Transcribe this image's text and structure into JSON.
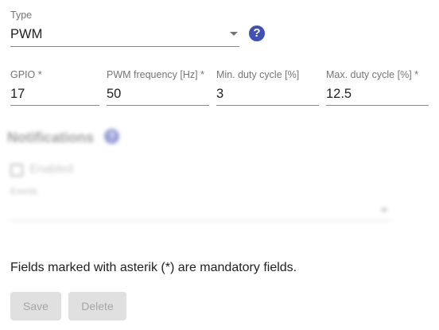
{
  "type_select": {
    "label": "Type",
    "value": "PWM",
    "help_icon": "?"
  },
  "inputs": {
    "gpio": {
      "label": "GPIO *",
      "value": "17"
    },
    "pwm_frequency": {
      "label": "PWM frequency [Hz] *",
      "value": "50"
    },
    "min_duty_cycle": {
      "label": "Min. duty cycle [%]",
      "value": "3"
    },
    "max_duty_cycle": {
      "label": "Max. duty cycle [%] *",
      "value": "12.5"
    }
  },
  "notifications": {
    "title": "Notifications",
    "help_icon": "?",
    "enabled_label": "Enabled",
    "events_label": "Events"
  },
  "footer": {
    "mandatory_note": "Fields marked with asterik (*) are mandatory fields.",
    "save_label": "Save",
    "delete_label": "Delete"
  },
  "colors": {
    "accent": "#3f51b5",
    "disabled_button_bg": "#e0e0e0",
    "disabled_button_text": "#a6a6a6"
  },
  "icons": {
    "type_help": "question-circle-icon",
    "notifications_help": "question-circle-icon",
    "dropdown": "chevron-down-icon"
  }
}
